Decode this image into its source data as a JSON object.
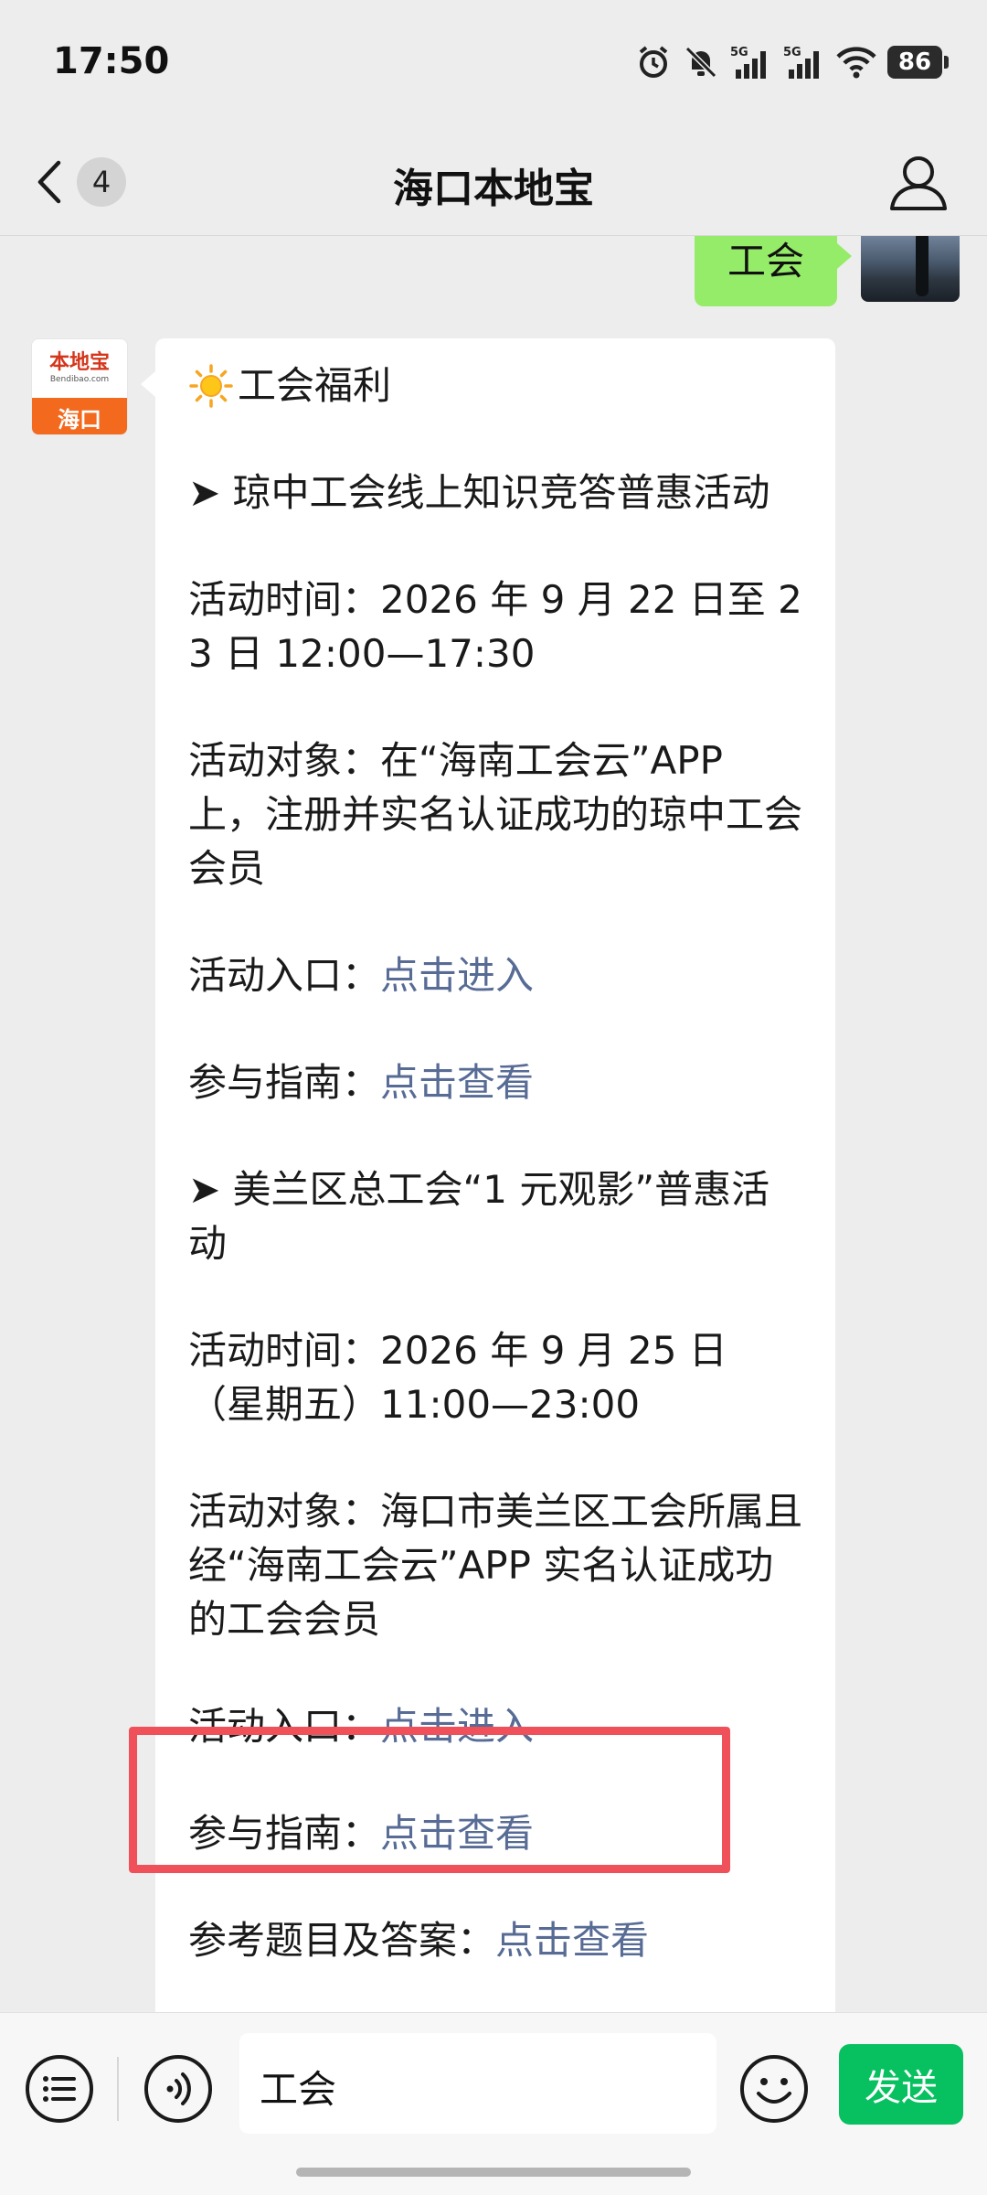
{
  "status_bar": {
    "time": "17:50",
    "battery": "86"
  },
  "nav": {
    "back_badge": "4",
    "title": "海口本地宝"
  },
  "chat": {
    "my_message": "工会",
    "bot_avatar": {
      "logo_text": "本地宝",
      "logo_url": "Bendibao.com",
      "city": "海口"
    },
    "bot_message": {
      "title": "工会福利",
      "p1": "➤ 琼中工会线上知识竞答普惠活动",
      "p2": "活动时间：2026 年 9 月 22 日至 23 日 12:00—17:30",
      "p3": "活动对象：在“海南工会云”APP 上，注册并实名认证成功的琼中工会会员",
      "p4_label": "活动入口：",
      "p4_link": "点击进入",
      "p5_label": "参与指南：",
      "p5_link": "点击查看",
      "p6": "➤ 美兰区总工会“1 元观影”普惠活动",
      "p7": "活动时间：2026 年 9 月 25 日（星期五）11:00—23:00",
      "p8": "活动对象：海口市美兰区工会所属且经“海南工会云”APP 实名认证成功的工会会员",
      "p9_label": "活动入口：",
      "p9_link": "点击进入",
      "p10_label": "参与指南：",
      "p10_link": "点击查看",
      "p11_label": "参考题目及答案：",
      "p11_link": "点击查看"
    }
  },
  "input_bar": {
    "text": "工会",
    "send_label": "发送"
  },
  "colors": {
    "accent_green": "#07c160",
    "bubble_green": "#95ec69",
    "link_blue": "#576b95",
    "highlight_red": "#f0505a"
  }
}
